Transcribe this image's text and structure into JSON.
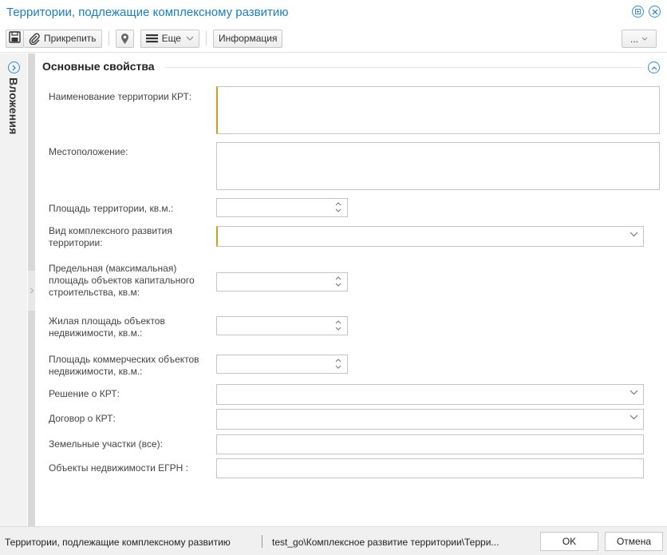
{
  "window": {
    "title": "Территории, подлежащие комплексному развитию"
  },
  "toolbar": {
    "attach_label": "Прикрепить",
    "more_label": "Еще",
    "info_label": "Информация",
    "overflow_label": "..."
  },
  "side_panel": {
    "label": "Вложения"
  },
  "section": {
    "title": "Основные свойства"
  },
  "fields": {
    "name_label": "Наименование территории КРТ:",
    "location_label": "Местоположение:",
    "area_label": "Площадь территории, кв.м.:",
    "dev_type_label": "Вид комплексного развития территории:",
    "max_area_label": "Предельная (максимальная) площадь объектов капитального строительства, кв.м:",
    "living_area_label": "Жилая площадь объектов недвижимости, кв.м.:",
    "commercial_area_label": "Площадь коммерческих объектов недвижимости, кв.м.:",
    "decision_label": "Решение о КРТ:",
    "contract_label": "Договор о КРТ:",
    "land_plots_label": "Земельные участки (все):",
    "egrn_objects_label": "Объекты недвижимости ЕГРН :"
  },
  "statusbar": {
    "layer_name": "Территории, подлежащие комплексному развитию",
    "path": "test_go\\Комплексное развитие территории\\Терри...",
    "ok_label": "OK",
    "cancel_label": "Отмена"
  }
}
